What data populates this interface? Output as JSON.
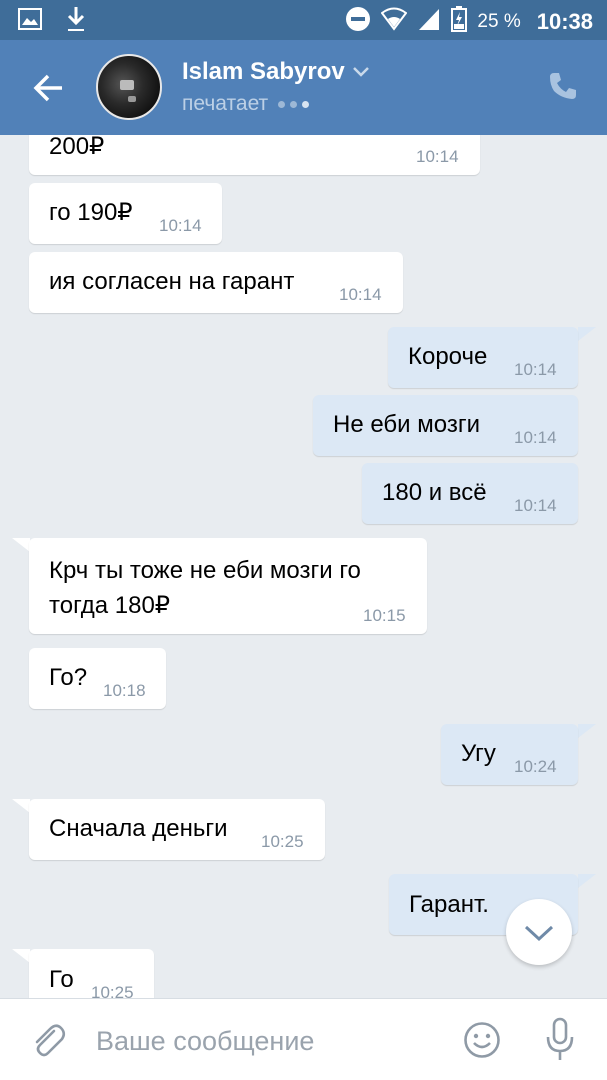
{
  "status_bar": {
    "battery_pct": "25 %",
    "time": "10:38",
    "icons": [
      "image-icon",
      "download-icon",
      "dnd-icon",
      "wifi-icon",
      "signal-icon",
      "battery-icon"
    ]
  },
  "header": {
    "name": "Islam Sabyrov",
    "status": "печатает"
  },
  "messages": [
    {
      "dir": "in",
      "text": "200₽",
      "time": "10:14"
    },
    {
      "dir": "in",
      "text": "го 190₽",
      "time": "10:14"
    },
    {
      "dir": "in",
      "text": "ия согласен на гарант",
      "time": "10:14"
    },
    {
      "dir": "out",
      "text": "Короче",
      "time": "10:14"
    },
    {
      "dir": "out",
      "text": "Не еби мозги",
      "time": "10:14"
    },
    {
      "dir": "out",
      "text": "180 и всё",
      "time": "10:14"
    },
    {
      "dir": "in",
      "text": "Крч ты тоже не еби мозги го",
      "text2": "тогда 180₽",
      "time": "10:15"
    },
    {
      "dir": "in",
      "text": "Го?",
      "time": "10:18"
    },
    {
      "dir": "out",
      "text": "Угу",
      "time": "10:24"
    },
    {
      "dir": "in",
      "text": "Сначала деньги",
      "time": "10:25"
    },
    {
      "dir": "out",
      "text": "Гарант.",
      "time": ""
    },
    {
      "dir": "in",
      "text": "Го",
      "time": "10:25"
    }
  ],
  "composer": {
    "placeholder": "Ваше сообщение"
  },
  "colors": {
    "header": "#5181b8",
    "status_bar": "#3f6d99",
    "chat_bg": "#e8ecf0",
    "out_bubble": "#dce8f5",
    "in_bubble": "#ffffff"
  }
}
